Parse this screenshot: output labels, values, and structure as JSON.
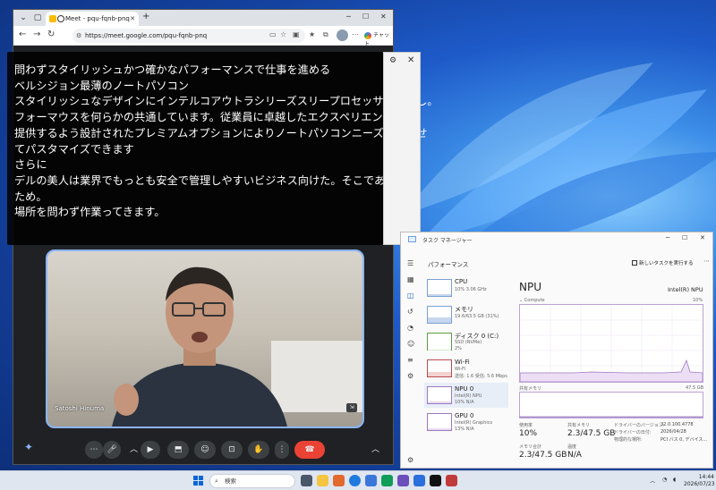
{
  "browser": {
    "tab_title": "Meet - pqu-fqnb-pnq",
    "url": "https://meet.google.com/pqu-fqnb-pnq",
    "chat_label": "チャット"
  },
  "caption": {
    "lines": [
      "問わずスタイリッシュかつ確かなパフォーマンスで仕事を進める",
      "ベルシジョン最薄のノートパソコン",
      "スタイリッシュなデザインにインテルコアウトラシリーズスリープロセッサを搭載し。",
      "フォーマウスを何らかの共通しています。従業員に卓越したエクスペリエンスを",
      "提供するよう設計されたプレミアムオプションによりノートパソコンニーズに合わせ",
      "てパスタマイズできます",
      "さらに",
      "デルの美人は業界でもっとも安全で管理しやすいビジネス向けた。そこである",
      "ため。",
      "場所を問わず作業ってきます。"
    ]
  },
  "meet": {
    "participant_name": "Satoshi Hinuma"
  },
  "taskmgr": {
    "window_title": "タスク マネージャー",
    "section_title": "パフォーマンス",
    "run_task_label": "新しいタスクを実行する",
    "items": [
      {
        "name": "CPU",
        "sub1": "10%  3.06 GHz",
        "sub2": "",
        "level": 0.1
      },
      {
        "name": "メモリ",
        "sub1": "19.6/63.5 GB (31%)",
        "sub2": "",
        "level": 0.31
      },
      {
        "name": "ディスク 0 (C:)",
        "sub1": "SSD (NVMe)",
        "sub2": "2%",
        "level": 0.02
      },
      {
        "name": "Wi-Fi",
        "sub1": "Wi-Fi",
        "sub2": "送信: 1.6  受信: 5.6 Mbps",
        "level": 0.3
      },
      {
        "name": "NPU 0",
        "sub1": "Intel(R) NPU",
        "sub2": "10%  N/A",
        "level": 0.1
      },
      {
        "name": "GPU 0",
        "sub1": "Intel(R) Graphics",
        "sub2": "13%  N/A",
        "level": 0.13
      }
    ],
    "main": {
      "title": "NPU",
      "model": "Intel(R) NPU",
      "compute_label": "Compute",
      "compute_max": "10%",
      "shared_mem_label": "共有メモリ",
      "shared_mem_max": "47.5 GB"
    },
    "stats": {
      "usage_label": "使用率",
      "usage_value": "10%",
      "shared_label": "共有メモリ",
      "shared_value": "2.3/47.5 GB",
      "mem_label": "メモリ合計",
      "mem_value": "2.3/47.5 GB",
      "temp_label": "温度",
      "temp_value": "N/A",
      "driver_ver_label": "ドライバーのバージョン:",
      "driver_ver_value": "32.0.100.4778",
      "driver_date_label": "ドライバーの日付:",
      "driver_date_value": "2026/04/28",
      "phys_label": "物理的な場所:",
      "phys_value": "PCI バス 0, デバイス..."
    }
  },
  "taskbar": {
    "search_placeholder": "検索",
    "time": "14:44",
    "date": "2026/07/23"
  },
  "colors": {
    "meet_bg": "#202124",
    "end_call": "#ea4335",
    "npu_accent": "#9b7ac0"
  }
}
